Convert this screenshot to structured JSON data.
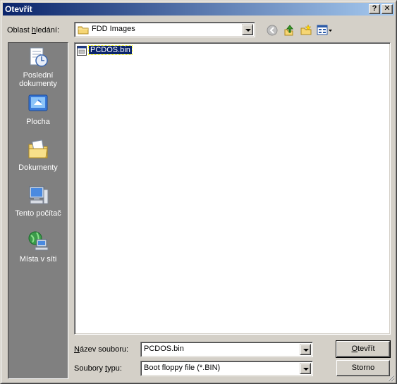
{
  "window": {
    "title": "Otevřít"
  },
  "titlebar": {
    "help_label": "?",
    "close_label": "✕"
  },
  "lookin": {
    "label": "Oblast hledání:",
    "label_pre": "Oblast ",
    "label_u": "h",
    "label_post": "ledání:",
    "value": "FDD Images"
  },
  "toolbar": {
    "back_icon": "back-arrow-icon",
    "up_icon": "up-folder-icon",
    "newfolder_icon": "new-folder-icon",
    "views_icon": "view-menu-icon"
  },
  "places": [
    {
      "label": "Poslední dokumenty",
      "icon": "recent-documents-icon"
    },
    {
      "label": "Plocha",
      "icon": "desktop-icon"
    },
    {
      "label": "Dokumenty",
      "icon": "my-documents-icon"
    },
    {
      "label": "Tento počítač",
      "icon": "my-computer-icon"
    },
    {
      "label": "Místa v síti",
      "icon": "network-places-icon"
    }
  ],
  "files": [
    {
      "name": "PCDOS.bin",
      "icon": "bin-file-icon"
    }
  ],
  "filename": {
    "label_pre": "",
    "label_u": "N",
    "label_post": "ázev souboru:",
    "value": "PCDOS.bin"
  },
  "filetype": {
    "label_pre": "Soubory ",
    "label_u": "t",
    "label_post": "ypu:",
    "value": "Boot floppy file (*.BIN)"
  },
  "buttons": {
    "open_pre": "",
    "open_u": "O",
    "open_post": "tevřít",
    "cancel": "Storno"
  },
  "colors": {
    "titlebar_start": "#0a246a",
    "titlebar_end": "#a6caf0",
    "face": "#d4d0c8",
    "places_bg": "#808080",
    "selection": "#0a246a"
  }
}
